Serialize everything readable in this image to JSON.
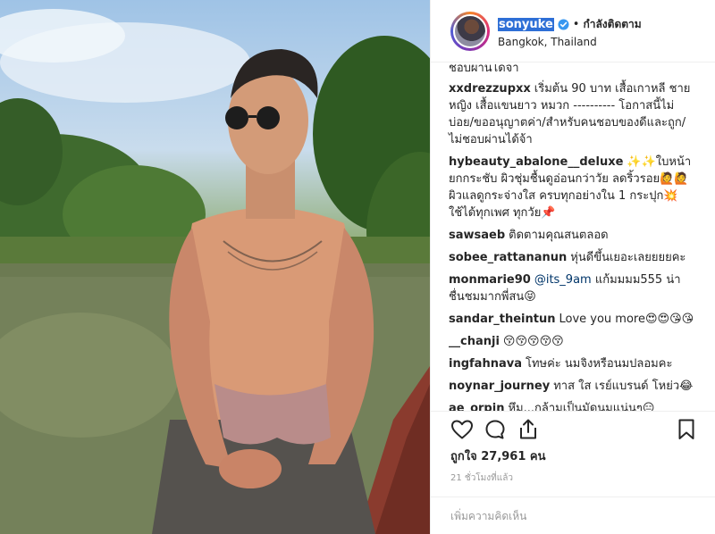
{
  "header": {
    "username": "sonyuke",
    "separator": "•",
    "follow_status": "กำลังติดตาม",
    "location": "Bangkok, Thailand"
  },
  "comments": {
    "partial_top": "ชอบผ่านได้จ้า",
    "items": [
      {
        "user": "xxdrezzupxx",
        "text": "เริ่มต้น 90 บาท เสื้อเกาหลี ชาย หญิง เสื้อแขนยาว หมวก ---------- โอกาสนี้ไม่บ่อย/ขออนุญาตค่า/สำหรับคนชอบของดีและถูก/ไม่ชอบผ่านได้จ้า"
      },
      {
        "user": "hybeauty_abalone__deluxe",
        "text": "✨✨ใบหน้ายกกระชับ ผิวชุ่มชื้นดูอ่อนกว่าวัย ลดริ้วรอย🙋🙋 ผิวแลดูกระจ่างใส ครบทุกอย่างใน 1 กระปุก💥 ใช้ได้ทุกเพศ ทุกวัย📌"
      },
      {
        "user": "sawsaeb",
        "text": "ติดตามคุณสนตลอด"
      },
      {
        "user": "sobee_rattananun",
        "text": "หุ่นดีขึ้นเยอะเลยยยยคะ"
      },
      {
        "user": "monmarie90",
        "mention": "@its_9am",
        "text": "แก้มมมม555 น่าชื่นชมมากพี่สน😝"
      },
      {
        "user": "sandar_theintun",
        "text": "Love you more😍😍😘😘"
      },
      {
        "user": "__chanji",
        "text": "😚😚😚😚😚"
      },
      {
        "user": "ingfahnava",
        "text": "โทษค่ะ นมจิงหรือนมปลอมคะ"
      },
      {
        "user": "noynar_journey",
        "text": "ทาส ใส เรย์แบรนด์ โหย่ว😂"
      },
      {
        "user": "ae_orpin",
        "text": "หึม...กล้ามเป็นมัดนมแน่นๆ😑"
      }
    ]
  },
  "actions": {
    "like_icon": "heart-icon",
    "comment_icon": "comment-bubble-icon",
    "share_icon": "share-icon",
    "save_icon": "bookmark-icon"
  },
  "likes": "ถูกใจ 27,961 คน",
  "time": "21 ชั่วโมงที่แล้ว",
  "add_comment": {
    "placeholder": "เพิ่มความคิดเห็น"
  },
  "colors": {
    "username_highlight": "#2e6fd6",
    "verified_badge": "#3897f0",
    "border": "#efefef",
    "muted_text": "#999999"
  }
}
